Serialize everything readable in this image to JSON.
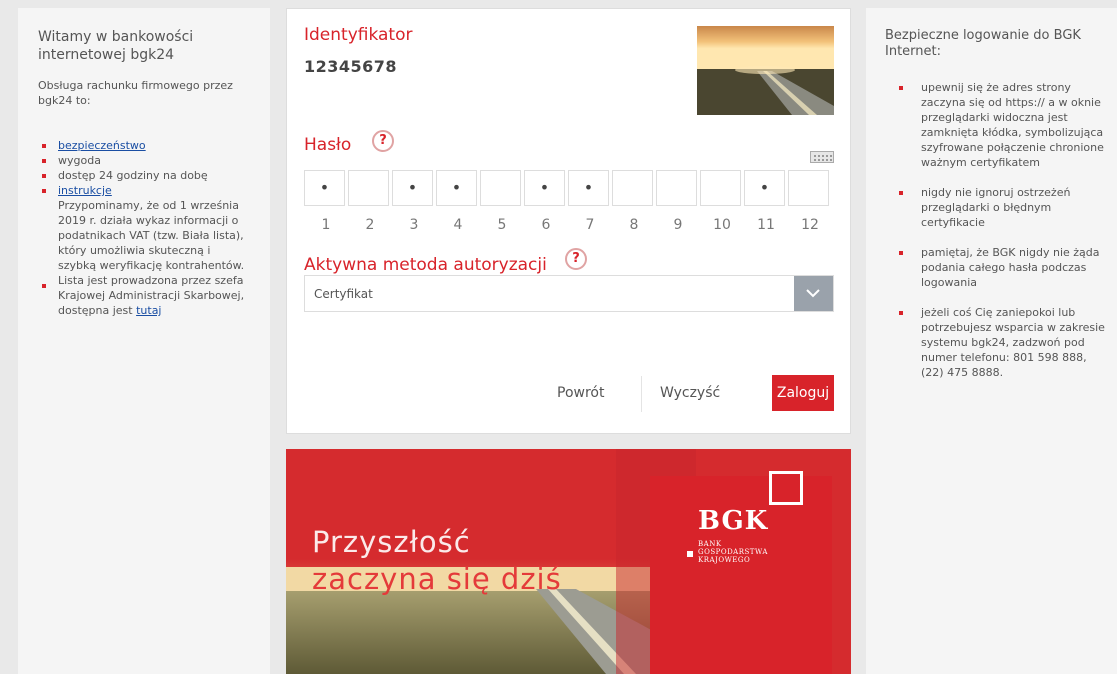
{
  "left": {
    "title": "Witamy w bankowości internetowej bgk24",
    "intro": "Obsługa rachunku firmowego przez bgk24 to:",
    "items": [
      {
        "text": "bezpieczeństwo",
        "link": true
      },
      {
        "text": "wygoda",
        "link": false
      },
      {
        "text": "dostęp 24 godziny na dobę",
        "link": false
      },
      {
        "text": "instrukcje",
        "link": true
      }
    ],
    "notice": "Przypominamy, że od 1 września 2019 r. działa wykaz informacji o podatnikach VAT (tzw. Biała lista), który umożliwia skuteczną i szybką weryfikację kontrahentów. Lista jest prowadzona przez szefa Krajowej Administracji Skarbowej, dostępna jest ",
    "notice_link": "tutaj"
  },
  "login": {
    "identifier_label": "Identyfikator",
    "identifier_value": "12345678",
    "password_label": "Hasło",
    "help_glyph": "?",
    "password_positions": [
      {
        "num": "1",
        "value": "•"
      },
      {
        "num": "2",
        "value": ""
      },
      {
        "num": "3",
        "value": "•"
      },
      {
        "num": "4",
        "value": "•"
      },
      {
        "num": "5",
        "value": ""
      },
      {
        "num": "6",
        "value": "•"
      },
      {
        "num": "7",
        "value": "•"
      },
      {
        "num": "8",
        "value": ""
      },
      {
        "num": "9",
        "value": ""
      },
      {
        "num": "10",
        "value": ""
      },
      {
        "num": "11",
        "value": "•"
      },
      {
        "num": "12",
        "value": ""
      }
    ],
    "auth_label": "Aktywna metoda autoryzacji",
    "auth_selected": "Certyfikat",
    "back_label": "Powrót",
    "clear_label": "Wyczyść",
    "login_label": "Zaloguj"
  },
  "banner": {
    "tagline_line1": "Przyszłość",
    "tagline_line2": "zaczyna się dziś",
    "logo_text": "BGK",
    "logo_sub": "BANK GOSPODARSTWA KRAJOWEGO"
  },
  "right": {
    "title": "Bezpieczne logowanie do BGK Internet:",
    "items": [
      "upewnij się że adres strony zaczyna się od https:// a w oknie przeglądarki widoczna jest zamknięta kłódka, symbolizująca szyfrowane połączenie chronione ważnym certyfikatem",
      "nigdy nie ignoruj ostrzeżeń przeglądarki o błędnym certyfikacie",
      "pamiętaj, że BGK nigdy nie żąda podania całego hasła podczas logowania",
      "jeżeli coś Cię zaniepokoi lub potrzebujesz wsparcia w zakresie systemu bgk24, zadzwoń pod numer telefonu: 801 598 888, (22) 475 8888."
    ]
  },
  "colors": {
    "brand_red": "#d8232a",
    "link_blue": "#1a4ea3",
    "panel_bg": "#f5f5f5",
    "page_bg": "#e9e9e9"
  },
  "icons": {
    "help": "question-circle-icon",
    "keyboard": "keyboard-icon",
    "dropdown": "chevron-down-icon",
    "bullet": "square-bullet-icon"
  }
}
